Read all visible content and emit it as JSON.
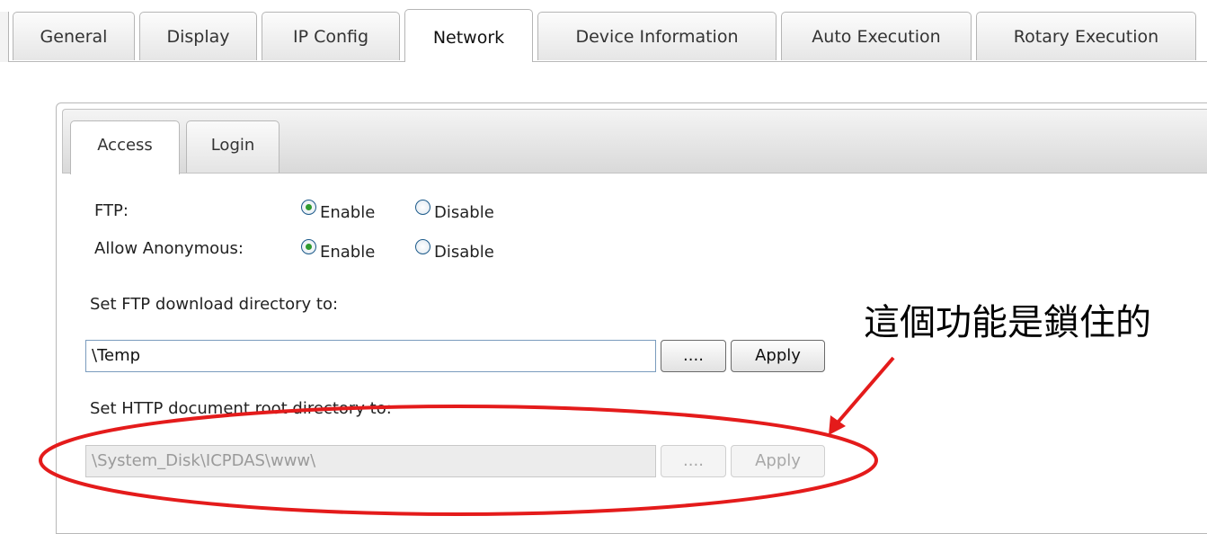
{
  "top_tabs": [
    {
      "label": "General"
    },
    {
      "label": "Display"
    },
    {
      "label": "IP Config"
    },
    {
      "label": "Network",
      "active": true
    },
    {
      "label": "Device Information"
    },
    {
      "label": "Auto Execution"
    },
    {
      "label": "Rotary Execution"
    }
  ],
  "sub_tabs": [
    {
      "label": "Access",
      "active": true
    },
    {
      "label": "Login"
    }
  ],
  "ftp": {
    "label": "FTP:",
    "enable_label": "Enable",
    "disable_label": "Disable",
    "selected": "Enable"
  },
  "anonymous": {
    "label": "Allow Anonymous:",
    "enable_label": "Enable",
    "disable_label": "Disable",
    "selected": "Enable"
  },
  "ftp_dir": {
    "label": "Set FTP download directory to:",
    "value": "\\Temp",
    "browse_label": "....",
    "apply_label": "Apply"
  },
  "http_dir": {
    "label": "Set HTTP document root directory to:",
    "value": "\\System_Disk\\ICPDAS\\www\\",
    "browse_label": "....",
    "apply_label": "Apply",
    "disabled": true
  },
  "annotation": {
    "text": "這個功能是鎖住的",
    "color": "#e41b1b"
  }
}
